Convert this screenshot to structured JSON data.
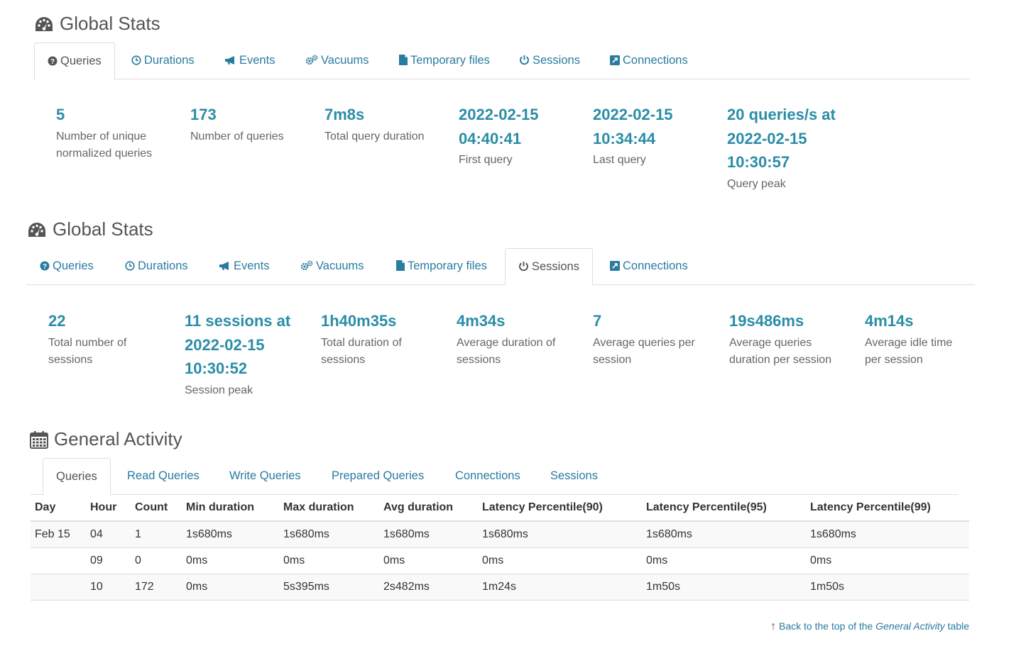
{
  "colors": {
    "link": "#2a7ba0",
    "value": "#2a8da7",
    "text": "#555555",
    "border": "#dddddd"
  },
  "stats_queries": {
    "title": "Global Stats",
    "icon": "dashboard-icon",
    "tabs": [
      {
        "label": "Queries",
        "icon": "question-circle-icon"
      },
      {
        "label": "Durations",
        "icon": "clock-icon"
      },
      {
        "label": "Events",
        "icon": "bullhorn-icon"
      },
      {
        "label": "Vacuums",
        "icon": "cogs-icon"
      },
      {
        "label": "Temporary files",
        "icon": "file-icon"
      },
      {
        "label": "Sessions",
        "icon": "power-icon"
      },
      {
        "label": "Connections",
        "icon": "external-link-icon"
      }
    ],
    "active_tab": "Queries",
    "items": [
      {
        "value": "5",
        "desc": "Number of unique normalized queries"
      },
      {
        "value": "173",
        "desc": "Number of queries"
      },
      {
        "value": "7m8s",
        "desc": "Total query duration"
      },
      {
        "value": "2022-02-15 04:40:41",
        "desc": "First query"
      },
      {
        "value": "2022-02-15 10:34:44",
        "desc": "Last query"
      },
      {
        "value": "20 queries/s at 2022-02-15 10:30:57",
        "desc": "Query peak"
      }
    ]
  },
  "stats_sessions": {
    "title": "Global Stats",
    "icon": "dashboard-icon",
    "tabs": [
      {
        "label": "Queries",
        "icon": "question-circle-icon"
      },
      {
        "label": "Durations",
        "icon": "clock-icon"
      },
      {
        "label": "Events",
        "icon": "bullhorn-icon"
      },
      {
        "label": "Vacuums",
        "icon": "cogs-icon"
      },
      {
        "label": "Temporary files",
        "icon": "file-icon"
      },
      {
        "label": "Sessions",
        "icon": "power-icon"
      },
      {
        "label": "Connections",
        "icon": "external-link-icon"
      }
    ],
    "active_tab": "Sessions",
    "items": [
      {
        "value": "22",
        "desc": "Total number of sessions"
      },
      {
        "value": "11 sessions at 2022-02-15 10:30:52",
        "desc": "Session peak"
      },
      {
        "value": "1h40m35s",
        "desc": "Total duration of sessions"
      },
      {
        "value": "4m34s",
        "desc": "Average duration of sessions"
      },
      {
        "value": "7",
        "desc": "Average queries per session"
      },
      {
        "value": "19s486ms",
        "desc": "Average queries duration per session"
      },
      {
        "value": "4m14s",
        "desc": "Average idle time per session"
      }
    ]
  },
  "activity": {
    "title": "General Activity",
    "icon": "calendar-icon",
    "tabs": [
      {
        "label": "Queries"
      },
      {
        "label": "Read Queries"
      },
      {
        "label": "Write Queries"
      },
      {
        "label": "Prepared Queries"
      },
      {
        "label": "Connections"
      },
      {
        "label": "Sessions"
      }
    ],
    "active_tab": "Queries",
    "columns": [
      "Day",
      "Hour",
      "Count",
      "Min duration",
      "Max duration",
      "Avg duration",
      "Latency Percentile(90)",
      "Latency Percentile(95)",
      "Latency Percentile(99)"
    ],
    "rows": [
      [
        "Feb 15",
        "04",
        "1",
        "1s680ms",
        "1s680ms",
        "1s680ms",
        "1s680ms",
        "1s680ms",
        "1s680ms"
      ],
      [
        "",
        "09",
        "0",
        "0ms",
        "0ms",
        "0ms",
        "0ms",
        "0ms",
        "0ms"
      ],
      [
        "",
        "10",
        "172",
        "0ms",
        "5s395ms",
        "2s482ms",
        "1m24s",
        "1m50s",
        "1m50s"
      ]
    ],
    "back_link": {
      "arrow": "↑",
      "prefix": "Back to the top of the",
      "em": "General Activity",
      "suffix": "table"
    }
  }
}
